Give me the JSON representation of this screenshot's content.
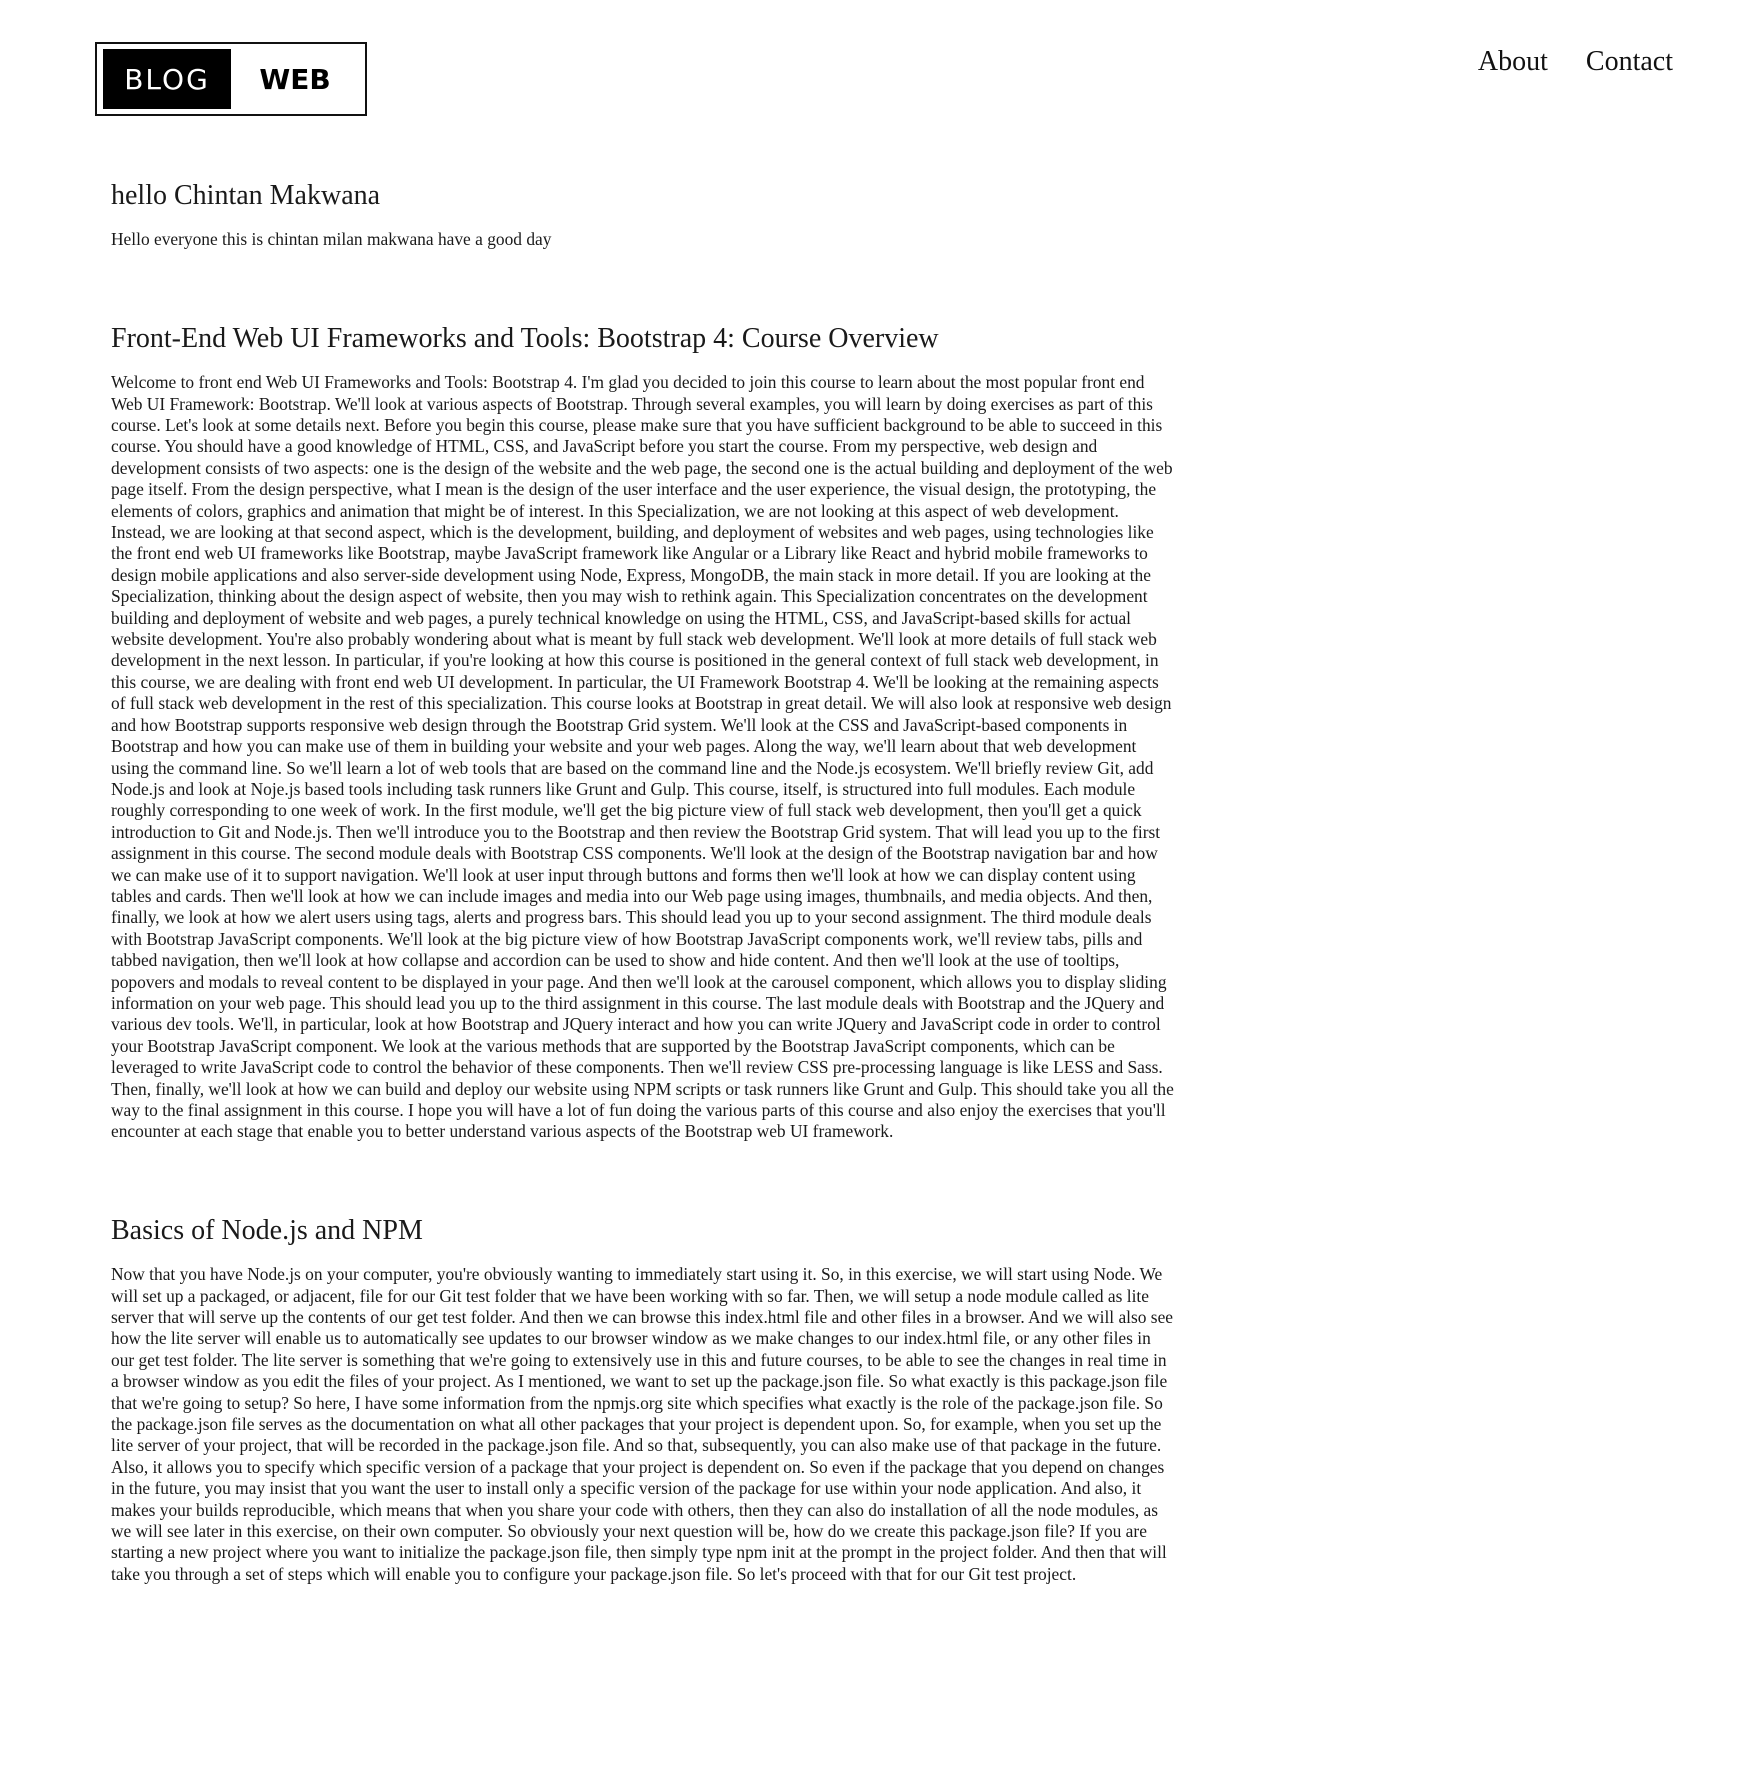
{
  "header": {
    "logo": {
      "left_text": "BLOG",
      "right_text": "WEB"
    },
    "nav": [
      {
        "label": "About"
      },
      {
        "label": "Contact"
      }
    ]
  },
  "posts": [
    {
      "title": "hello Chintan Makwana",
      "body": "Hello everyone this is chintan milan makwana have a good day"
    },
    {
      "title": "Front-End Web UI Frameworks and Tools: Bootstrap 4: Course Overview",
      "body": "Welcome to front end Web UI Frameworks and Tools: Bootstrap 4. I'm glad you decided to join this course to learn about the most popular front end Web UI Framework: Bootstrap. We'll look at various aspects of Bootstrap. Through several examples, you will learn by doing exercises as part of this course. Let's look at some details next. Before you begin this course, please make sure that you have sufficient background to be able to succeed in this course. You should have a good knowledge of HTML, CSS, and JavaScript before you start the course. From my perspective, web design and development consists of two aspects: one is the design of the website and the web page, the second one is the actual building and deployment of the web page itself. From the design perspective, what I mean is the design of the user interface and the user experience, the visual design, the prototyping, the elements of colors, graphics and animation that might be of interest. In this Specialization, we are not looking at this aspect of web development. Instead, we are looking at that second aspect, which is the development, building, and deployment of websites and web pages, using technologies like the front end web UI frameworks like Bootstrap, maybe JavaScript framework like Angular or a Library like React and hybrid mobile frameworks to design mobile applications and also server-side development using Node, Express, MongoDB, the main stack in more detail. If you are looking at the Specialization, thinking about the design aspect of website, then you may wish to rethink again. This Specialization concentrates on the development building and deployment of website and web pages, a purely technical knowledge on using the HTML, CSS, and JavaScript-based skills for actual website development. You're also probably wondering about what is meant by full stack web development. We'll look at more details of full stack web development in the next lesson. In particular, if you're looking at how this course is positioned in the general context of full stack web development, in this course, we are dealing with front end web UI development. In particular, the UI Framework Bootstrap 4. We'll be looking at the remaining aspects of full stack web development in the rest of this specialization. This course looks at Bootstrap in great detail. We will also look at responsive web design and how Bootstrap supports responsive web design through the Bootstrap Grid system. We'll look at the CSS and JavaScript-based components in Bootstrap and how you can make use of them in building your website and your web pages. Along the way, we'll learn about that web development using the command line. So we'll learn a lot of web tools that are based on the command line and the Node.js ecosystem. We'll briefly review Git, add Node.js and look at Noje.js based tools including task runners like Grunt and Gulp. This course, itself, is structured into full modules. Each module roughly corresponding to one week of work. In the first module, we'll get the big picture view of full stack web development, then you'll get a quick introduction to Git and Node.js. Then we'll introduce you to the Bootstrap and then review the Bootstrap Grid system. That will lead you up to the first assignment in this course. The second module deals with Bootstrap CSS components. We'll look at the design of the Bootstrap navigation bar and how we can make use of it to support navigation. We'll look at user input through buttons and forms then we'll look at how we can display content using tables and cards. Then we'll look at how we can include images and media into our Web page using images, thumbnails, and media objects. And then, finally, we look at how we alert users using tags, alerts and progress bars. This should lead you up to your second assignment. The third module deals with Bootstrap JavaScript components. We'll look at the big picture view of how Bootstrap JavaScript components work, we'll review tabs, pills and tabbed navigation, then we'll look at how collapse and accordion can be used to show and hide content. And then we'll look at the use of tooltips, popovers and modals to reveal content to be displayed in your page. And then we'll look at the carousel component, which allows you to display sliding information on your web page. This should lead you up to the third assignment in this course. The last module deals with Bootstrap and the JQuery and various dev tools. We'll, in particular, look at how Bootstrap and JQuery interact and how you can write JQuery and JavaScript code in order to control your Bootstrap JavaScript component. We look at the various methods that are supported by the Bootstrap JavaScript components, which can be leveraged to write JavaScript code to control the behavior of these components. Then we'll review CSS pre-processing language is like LESS and Sass. Then, finally, we'll look at how we can build and deploy our website using NPM scripts or task runners like Grunt and Gulp. This should take you all the way to the final assignment in this course. I hope you will have a lot of fun doing the various parts of this course and also enjoy the exercises that you'll encounter at each stage that enable you to better understand various aspects of the Bootstrap web UI framework."
    },
    {
      "title": "Basics of Node.js and NPM",
      "body": "Now that you have Node.js on your computer, you're obviously wanting to immediately start using it. So, in this exercise, we will start using Node. We will set up a packaged, or adjacent, file for our Git test folder that we have been working with so far. Then, we will setup a node module called as lite server that will serve up the contents of our get test folder. And then we can browse this index.html file and other files in a browser. And we will also see how the lite server will enable us to automatically see updates to our browser window as we make changes to our index.html file, or any other files in our get test folder. The lite server is something that we're going to extensively use in this and future courses, to be able to see the changes in real time in a browser window as you edit the files of your project. As I mentioned, we want to set up the package.json file. So what exactly is this package.json file that we're going to setup? So here, I have some information from the npmjs.org site which specifies what exactly is the role of the package.json file. So the package.json file serves as the documentation on what all other packages that your project is dependent upon. So, for example, when you set up the lite server of your project, that will be recorded in the package.json file. And so that, subsequently, you can also make use of that package in the future. Also, it allows you to specify which specific version of a package that your project is dependent on. So even if the package that you depend on changes in the future, you may insist that you want the user to install only a specific version of the package for use within your node application. And also, it makes your builds reproducible, which means that when you share your code with others, then they can also do installation of all the node modules, as we will see later in this exercise, on their own computer. So obviously your next question will be, how do we create this package.json file? If you are starting a new project where you want to initialize the package.json file, then simply type npm init at the prompt in the project folder. And then that will take you through a set of steps which will enable you to configure your package.json file. So let's proceed with that for our Git test project."
    }
  ]
}
